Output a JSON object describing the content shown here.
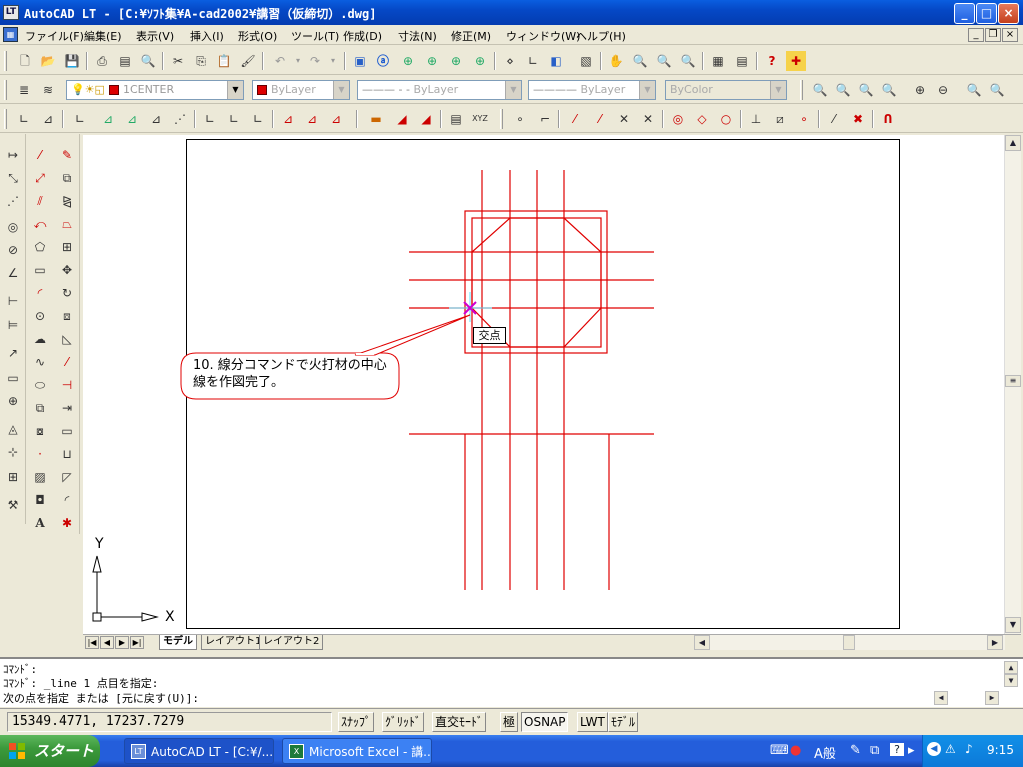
{
  "window": {
    "title": "AutoCAD LT - [C:¥ｿﾌﾄ集¥A-cad2002¥講習（仮締切）.dwg]",
    "app_icon": "LT"
  },
  "menu": [
    "ファイル(F)",
    "編集(E)",
    "表示(V)",
    "挿入(I)",
    "形式(O)",
    "ツール(T)",
    "作成(D)",
    "寸法(N)",
    "修正(M)",
    "ウィンドウ(W)",
    "ヘルプ(H)"
  ],
  "properties": {
    "layer": "1CENTER",
    "color": "ByLayer",
    "linetype": "ByLayer",
    "lineweight": "ByLayer",
    "plotstyle": "ByColor"
  },
  "drawing": {
    "callout_text": "10. 線分コマンドで火打材の中心線を作図完了。",
    "snap_tooltip": "交点",
    "ucs_x": "X",
    "ucs_y": "Y",
    "line_color": "#e00000"
  },
  "layout_tabs": [
    "モデル",
    "レイアウト1",
    "レイアウト2"
  ],
  "command": {
    "line1": "ｺﾏﾝﾄﾞ:",
    "line2": "ｺﾏﾝﾄﾞ: _line 1 点目を指定:",
    "line3": "次の点を指定 または [元に戻す(U)]:"
  },
  "status": {
    "coords": "15349.4771, 17237.7279",
    "buttons": [
      "ｽﾅｯﾌﾟ",
      "ｸﾞﾘｯﾄﾞ",
      "直交ﾓｰﾄﾞ",
      "極",
      "OSNAP",
      "LWT",
      "ﾓﾃﾞﾙ"
    ]
  },
  "taskbar": {
    "start": "スタート",
    "tasks": [
      "AutoCAD LT - [C:¥/...",
      "Microsoft Excel - 講..."
    ],
    "clock": "9:15",
    "ime": "A般"
  }
}
